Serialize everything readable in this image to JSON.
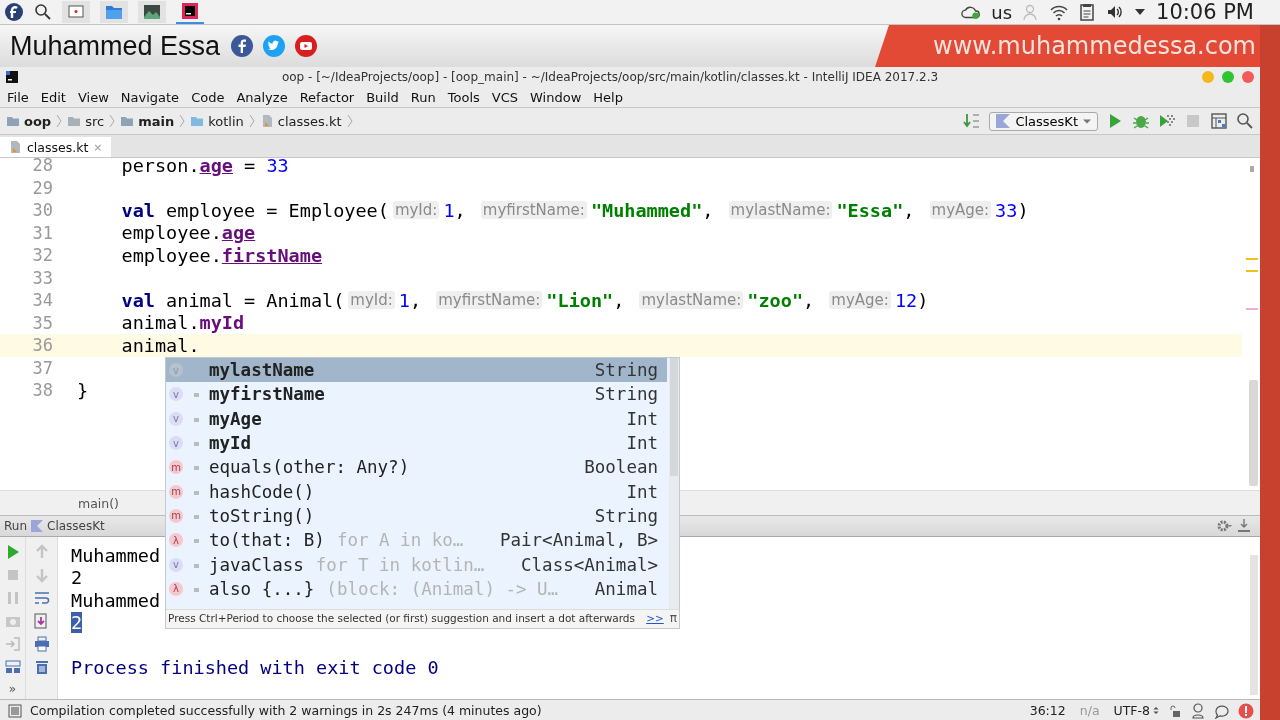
{
  "system_bar": {
    "keyboard": "us",
    "clock": "10:06 PM"
  },
  "banner": {
    "name": "Muhammed Essa",
    "website": "www.muhammedessa.com"
  },
  "window": {
    "title": "oop - [~/IdeaProjects/oop] - [oop_main] - ~/IdeaProjects/oop/src/main/kotlin/classes.kt - IntelliJ IDEA 2017.2.3"
  },
  "menu": [
    "File",
    "Edit",
    "View",
    "Navigate",
    "Code",
    "Analyze",
    "Refactor",
    "Build",
    "Run",
    "Tools",
    "VCS",
    "Window",
    "Help"
  ],
  "breadcrumbs": [
    {
      "label": "oop",
      "kind": "module",
      "bold": true
    },
    {
      "label": "src",
      "kind": "folder",
      "bold": false
    },
    {
      "label": "main",
      "kind": "module",
      "bold": true
    },
    {
      "label": "kotlin",
      "kind": "source",
      "bold": false
    },
    {
      "label": "classes.kt",
      "kind": "file",
      "bold": false
    }
  ],
  "run_config": {
    "label": "ClassesKt"
  },
  "tabs": [
    {
      "label": "classes.kt",
      "close": "×",
      "selected": true
    }
  ],
  "editor": {
    "lines": [
      {
        "number": "28",
        "current": false,
        "tokens": [
          {
            "kind": "plain",
            "text": "    person."
          },
          {
            "kind": "var",
            "text": "age"
          },
          {
            "kind": "plain",
            "text": " = "
          },
          {
            "kind": "number",
            "text": "33"
          }
        ]
      },
      {
        "number": "29",
        "current": false
      },
      {
        "number": "30",
        "current": false,
        "tokens": [
          {
            "kind": "keyword",
            "text": "    val"
          },
          {
            "kind": "plain",
            "text": " employee = Employee("
          },
          {
            "kind": "hint",
            "text": "myId:"
          },
          {
            "kind": "number",
            "text": "1"
          },
          {
            "kind": "plain",
            "text": ", "
          },
          {
            "kind": "hint",
            "text": "myfirstName:"
          },
          {
            "kind": "string",
            "text": "\"Muhammed\""
          },
          {
            "kind": "plain",
            "text": ", "
          },
          {
            "kind": "hint",
            "text": "mylastName:"
          },
          {
            "kind": "string",
            "text": "\"Essa\""
          },
          {
            "kind": "plain",
            "text": ", "
          },
          {
            "kind": "hint",
            "text": "myAge:"
          },
          {
            "kind": "number",
            "text": "33"
          },
          {
            "kind": "plain",
            "text": ")"
          }
        ]
      },
      {
        "number": "31",
        "current": false,
        "tokens": [
          {
            "kind": "plain",
            "text": "    employee."
          },
          {
            "kind": "var",
            "text": "age"
          }
        ]
      },
      {
        "number": "32",
        "current": false,
        "tokens": [
          {
            "kind": "plain",
            "text": "    employee."
          },
          {
            "kind": "var",
            "text": "firstName"
          }
        ]
      },
      {
        "number": "33",
        "current": false
      },
      {
        "number": "34",
        "current": false,
        "tokens": [
          {
            "kind": "keyword",
            "text": "    val"
          },
          {
            "kind": "plain",
            "text": " animal = Animal("
          },
          {
            "kind": "hint",
            "text": "myId:"
          },
          {
            "kind": "number",
            "text": "1"
          },
          {
            "kind": "plain",
            "text": ", "
          },
          {
            "kind": "hint",
            "text": "myfirstName:"
          },
          {
            "kind": "string",
            "text": "\"Lion\""
          },
          {
            "kind": "plain",
            "text": ", "
          },
          {
            "kind": "hint",
            "text": "mylastName:"
          },
          {
            "kind": "string",
            "text": "\"zoo\""
          },
          {
            "kind": "plain",
            "text": ", "
          },
          {
            "kind": "hint",
            "text": "myAge:"
          },
          {
            "kind": "number",
            "text": "12"
          },
          {
            "kind": "plain",
            "text": ")"
          }
        ]
      },
      {
        "number": "35",
        "current": false,
        "tokens": [
          {
            "kind": "plain",
            "text": "    animal."
          },
          {
            "kind": "val",
            "text": "myId"
          }
        ]
      },
      {
        "number": "36",
        "current": true,
        "tokens": [
          {
            "kind": "plain",
            "text": "    animal."
          }
        ]
      },
      {
        "number": "37",
        "current": false
      },
      {
        "number": "38",
        "current": false,
        "tokens": [
          {
            "kind": "plain",
            "text": "}"
          }
        ]
      }
    ],
    "breadcrumb": "main()"
  },
  "completion": {
    "items": [
      {
        "kind": "property",
        "badge": "v",
        "name": "mylastName",
        "type": "String",
        "bold": true,
        "selected": true
      },
      {
        "kind": "property",
        "badge": "v",
        "name": "myfirstName",
        "type": "String",
        "bold": true,
        "selected": false
      },
      {
        "kind": "property",
        "badge": "v",
        "name": "myAge",
        "type": "Int",
        "bold": true,
        "selected": false
      },
      {
        "kind": "property",
        "badge": "v",
        "name": "myId",
        "type": "Int",
        "bold": true,
        "selected": false
      },
      {
        "kind": "method",
        "badge": "m",
        "name": "equals(other: Any?)",
        "type": "Boolean",
        "bold": false,
        "selected": false
      },
      {
        "kind": "method",
        "badge": "m",
        "name": "hashCode()",
        "type": "Int",
        "bold": false,
        "selected": false
      },
      {
        "kind": "method",
        "badge": "m",
        "name": "toString()",
        "type": "String",
        "bold": false,
        "selected": false
      },
      {
        "kind": "extension",
        "badge": "λ",
        "name": "to(that: B)",
        "tail": "for A in ko…",
        "type": "Pair<Animal, B>",
        "bold": false,
        "selected": false
      },
      {
        "kind": "property",
        "badge": "v",
        "name": "javaClass",
        "tail": "for T in kotlin…",
        "type": "Class<Animal>",
        "bold": false,
        "selected": false
      },
      {
        "kind": "extension",
        "badge": "λ",
        "name": "also {...}",
        "tail": "(block: (Animal) -> U…",
        "type": "Animal",
        "bold": false,
        "selected": false
      }
    ],
    "hint": "Press Ctrl+Period to choose the selected (or first) suggestion and insert a dot afterwards",
    "more": ">>",
    "pin": "π"
  },
  "run_panel": {
    "label": "Run",
    "config": "ClassesKt",
    "overflow": "»",
    "lines": [
      {
        "text": "Muhammed",
        "selected": false
      },
      {
        "text": "2",
        "selected": false
      },
      {
        "text": "Muhammed",
        "selected": false
      },
      {
        "text": "2",
        "selected": true
      }
    ],
    "exit_message": "Process finished with exit code 0"
  },
  "status_bar": {
    "message": "Compilation completed successfully with 2 warnings in 2s 247ms (4 minutes ago)",
    "position": "36:12",
    "line_separator": "n/a",
    "encoding": "UTF-8"
  }
}
